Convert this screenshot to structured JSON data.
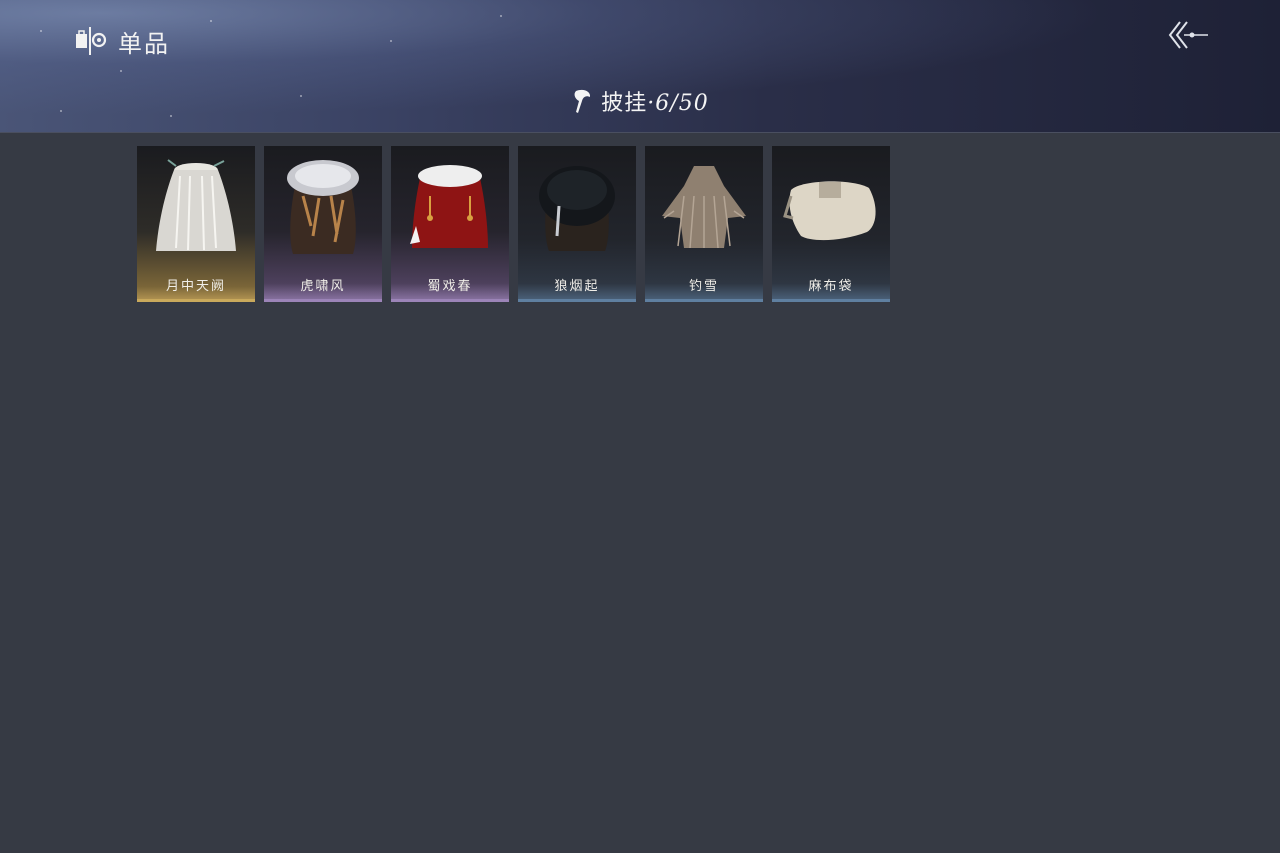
{
  "header": {
    "section_label": "单品",
    "section_icon": "wardrobe-icon",
    "back_icon": "back-arrow-icon"
  },
  "category": {
    "icon": "cape-icon",
    "name": "披挂",
    "separator": "·",
    "count": "6/50"
  },
  "items": [
    {
      "name": "月中天阙",
      "rarity": "gold",
      "icon": "white-feather-cape"
    },
    {
      "name": "虎啸风",
      "rarity": "purple",
      "icon": "tiger-fur-cape"
    },
    {
      "name": "蜀戏春",
      "rarity": "purple",
      "icon": "red-fur-collar-cape"
    },
    {
      "name": "狼烟起",
      "rarity": "blue",
      "icon": "black-fur-cape"
    },
    {
      "name": "钓雪",
      "rarity": "blue",
      "icon": "straw-raincoat"
    },
    {
      "name": "麻布袋",
      "rarity": "blue",
      "icon": "burlap-sack"
    }
  ],
  "colors": {
    "background": "#363a44",
    "gold": "#c9a95c",
    "purple": "#9c84b8",
    "blue": "#5f7fa0"
  }
}
